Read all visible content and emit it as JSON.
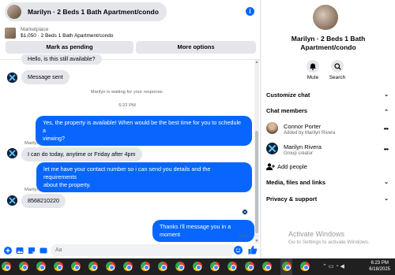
{
  "header": {
    "title": "Marilyn · 2 Beds 1 Bath Apartment/condo"
  },
  "marketplace": {
    "label": "Marketplace",
    "item": "$1,050 · 2 Beds 1 Bath Apartment/condo",
    "pending_label": "Mark as pending",
    "more_label": "More options"
  },
  "messages": {
    "m1": "Hello, is this still available?",
    "m2": "Message sent",
    "waiting": "Marilyn is waiting for your response.",
    "time": "6:22 PM",
    "m3_l1": "Yes, the property is available! When would be the best time for you to schedule a",
    "m3_l2": "viewing?",
    "sender1": "Marilyn",
    "m4": "I can do today, anytime or Friday after 4pm",
    "m5_l1": "let me have your contact number so i can send you details and the requirements",
    "m5_l2": "about the property.",
    "sender2": "Marilyn",
    "m6": "8568210220",
    "m7": "Thanks i'll message you in a moment",
    "sent": "Sent"
  },
  "composer": {
    "placeholder": "Aa"
  },
  "right": {
    "title_l1": "Marilyn · 2 Beds 1 Bath",
    "title_l2": "Apartment/condo",
    "mute": "Mute",
    "search": "Search",
    "customize": "Customize chat",
    "members": "Chat members",
    "member1_name": "Connor Porter",
    "member1_sub": "Added by Marilyn Rivera",
    "member2_name": "Marilyn Rivera",
    "member2_sub": "Group creator",
    "add_people": "Add people",
    "media": "Media, files and links",
    "privacy": "Privacy & support"
  },
  "windows": {
    "activate": "Activate Windows",
    "activate_sub": "Go to Settings to activate Windows."
  },
  "taskbar": {
    "time": "6:23 PM",
    "date": "6/18/2025"
  },
  "colors": {
    "accent": "#0866ff",
    "bubble_in": "#e4e6eb",
    "taskbar": "#202020"
  }
}
